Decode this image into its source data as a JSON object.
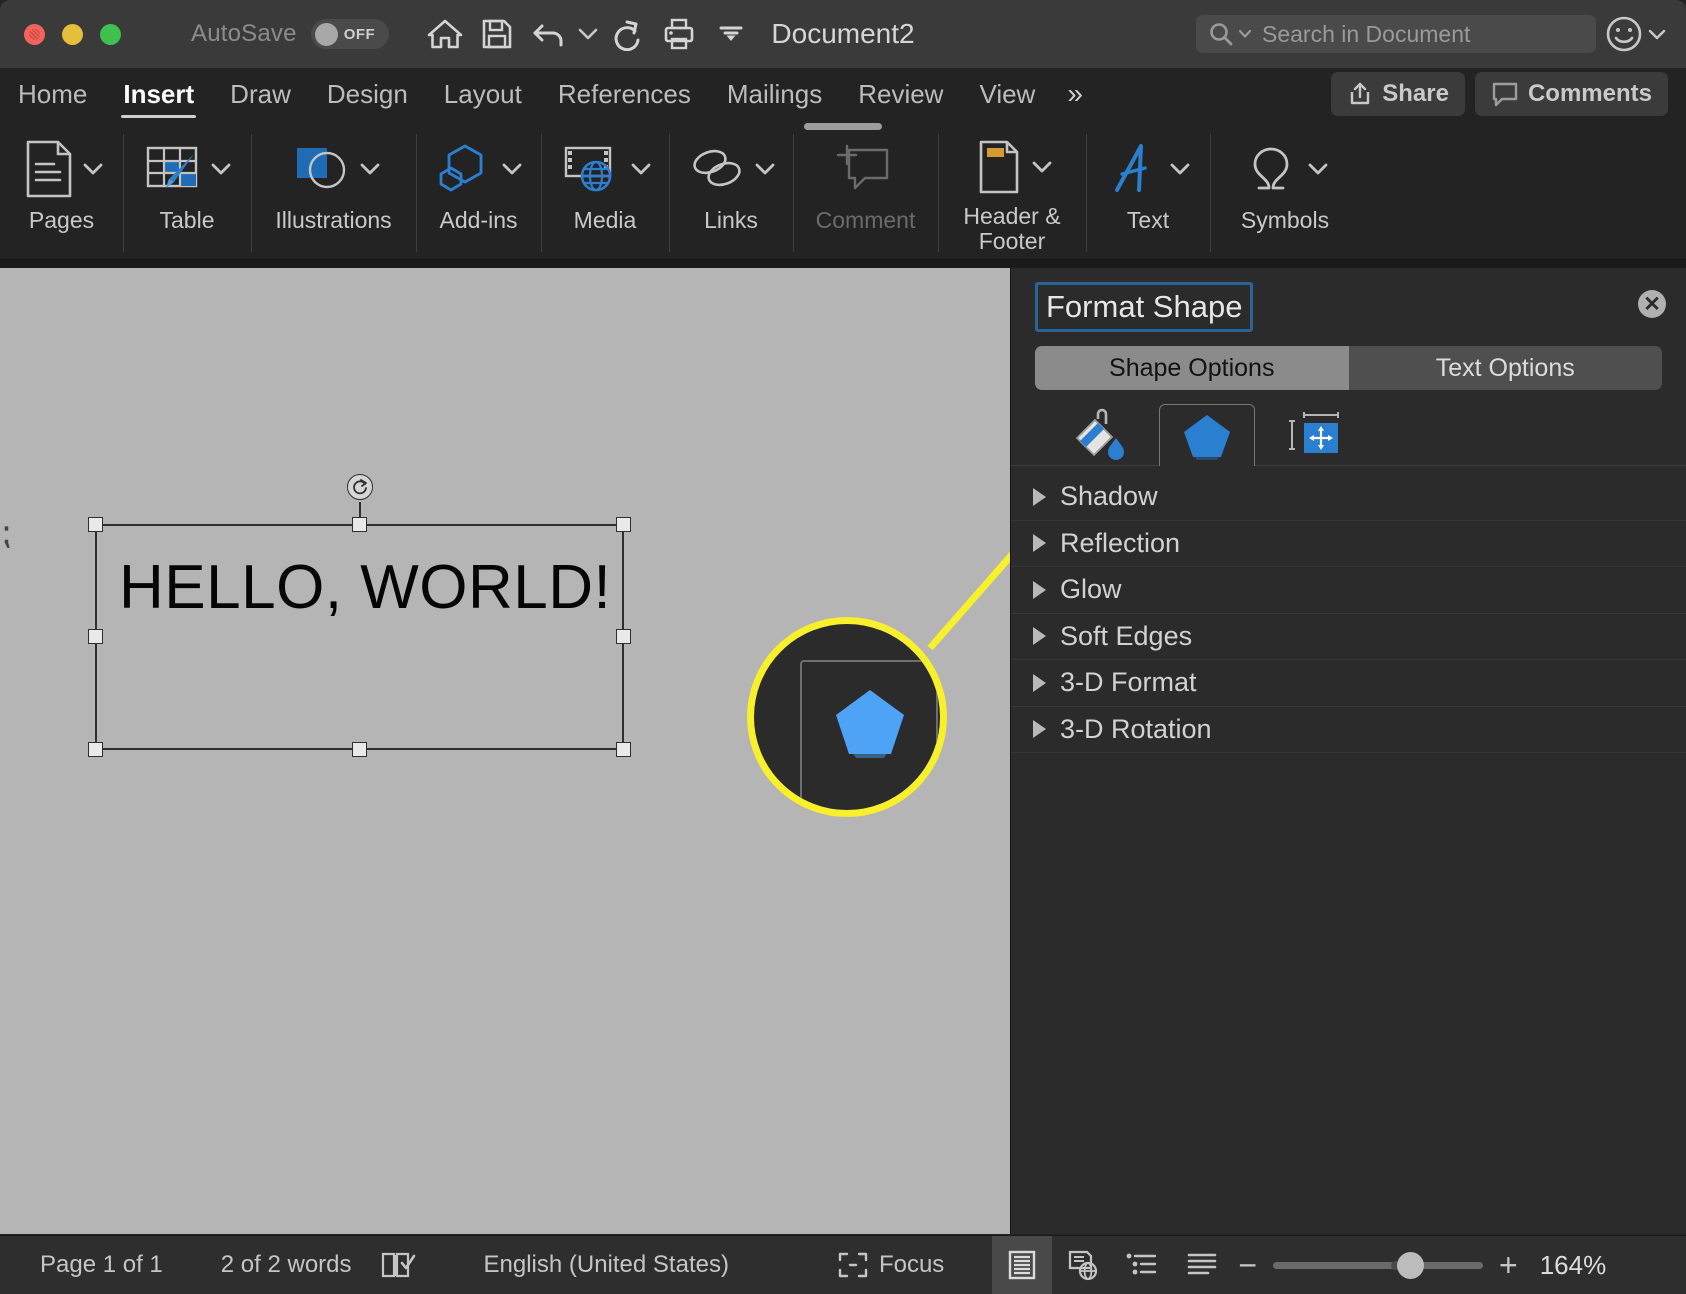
{
  "titlebar": {
    "autosave_label": "AutoSave",
    "autosave_state": "OFF",
    "document_title": "Document2",
    "quick_access": [
      {
        "name": "home-icon",
        "label": "Home"
      },
      {
        "name": "save-icon",
        "label": "Save"
      },
      {
        "name": "undo-icon",
        "label": "Undo"
      },
      {
        "name": "undo-dropdown-icon",
        "label": "Undo options"
      },
      {
        "name": "redo-icon",
        "label": "Redo"
      },
      {
        "name": "print-icon",
        "label": "Print"
      },
      {
        "name": "customize-toolbar-icon",
        "label": "Customize Toolbar"
      }
    ],
    "search": {
      "placeholder": "Search in Document",
      "icon": "search-icon"
    },
    "emoji_icon": "smiley-face-icon",
    "window_buttons": [
      "close-button",
      "minimize-button",
      "zoom-button"
    ]
  },
  "ribbon": {
    "tabs": [
      {
        "label": "Home",
        "active": false
      },
      {
        "label": "Insert",
        "active": true
      },
      {
        "label": "Draw",
        "active": false
      },
      {
        "label": "Design",
        "active": false
      },
      {
        "label": "Layout",
        "active": false
      },
      {
        "label": "References",
        "active": false
      },
      {
        "label": "Mailings",
        "active": false
      },
      {
        "label": "Review",
        "active": false
      },
      {
        "label": "View",
        "active": false
      }
    ],
    "overflow_label": "»",
    "share_label": "Share",
    "comments_label": "Comments",
    "groups": [
      {
        "label": "Pages",
        "icon": "pages-icon",
        "has_dropdown": true,
        "disabled": false
      },
      {
        "label": "Table",
        "icon": "table-icon",
        "has_dropdown": true,
        "disabled": false
      },
      {
        "label": "Illustrations",
        "icon": "illustrations-icon",
        "has_dropdown": true,
        "disabled": false
      },
      {
        "label": "Add-ins",
        "icon": "addins-icon",
        "has_dropdown": true,
        "disabled": false
      },
      {
        "label": "Media",
        "icon": "media-icon",
        "has_dropdown": true,
        "disabled": false
      },
      {
        "label": "Links",
        "icon": "links-icon",
        "has_dropdown": true,
        "disabled": false
      },
      {
        "label": "Comment",
        "icon": "comment-icon",
        "has_dropdown": false,
        "disabled": true
      },
      {
        "label": "Header & Footer",
        "icon": "header-footer-icon",
        "has_dropdown": true,
        "disabled": false
      },
      {
        "label": "Text",
        "icon": "text-icon",
        "has_dropdown": true,
        "disabled": false
      },
      {
        "label": "Symbols",
        "icon": "symbols-icon",
        "has_dropdown": true,
        "disabled": false
      }
    ]
  },
  "document": {
    "textbox_text": "HELLO, WORLD!",
    "rotate_handle": "rotate-handle"
  },
  "callout": {
    "highlight_color": "#f7f02b",
    "magnified_item": "effects-pentagon-icon"
  },
  "panel": {
    "title": "Format Shape",
    "close_label": "✕",
    "segmented": [
      {
        "label": "Shape Options",
        "selected": true
      },
      {
        "label": "Text Options",
        "selected": false
      }
    ],
    "icon_tabs": [
      {
        "name": "fill-line-icon",
        "selected": false
      },
      {
        "name": "effects-pentagon-icon",
        "selected": true
      },
      {
        "name": "layout-properties-icon",
        "selected": false
      }
    ],
    "effects": [
      {
        "label": "Shadow",
        "expanded": false
      },
      {
        "label": "Reflection",
        "expanded": false
      },
      {
        "label": "Glow",
        "expanded": false
      },
      {
        "label": "Soft Edges",
        "expanded": false
      },
      {
        "label": "3-D Format",
        "expanded": false
      },
      {
        "label": "3-D Rotation",
        "expanded": false
      }
    ]
  },
  "statusbar": {
    "page_count": "Page 1 of 1",
    "word_count": "2 of 2 words",
    "proofing_icon": "proofing-check-icon",
    "language": "English (United States)",
    "focus_label": "Focus",
    "views": [
      {
        "name": "print-layout-view-icon",
        "active": true
      },
      {
        "name": "web-layout-view-icon",
        "active": false
      },
      {
        "name": "outline-view-icon",
        "active": false
      },
      {
        "name": "draft-view-icon",
        "active": false
      }
    ],
    "zoom_out_label": "−",
    "zoom_in_label": "+",
    "zoom_level": "164%"
  },
  "colors": {
    "accent_blue": "#2a7fd0",
    "highlight_yellow": "#f7f02b",
    "panel_bg": "#2b2b2b",
    "canvas_bg": "#b5b5b5"
  }
}
